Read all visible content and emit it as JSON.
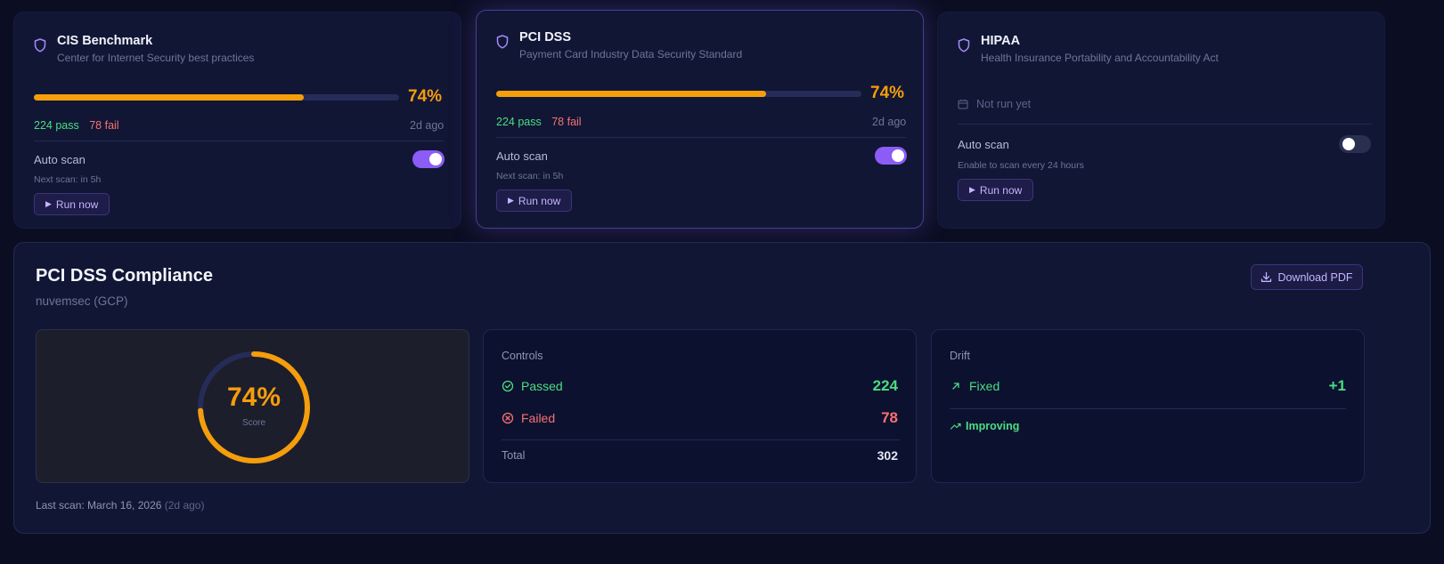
{
  "frameworks": [
    {
      "title": "CIS Benchmark",
      "subtitle": "Center for Internet Security best practices",
      "score_pct_value": 0.74,
      "score_pct": "74%",
      "pass": "224 pass",
      "fail": "78 fail",
      "ago": "2d ago",
      "auto_scan_label": "Auto scan",
      "auto_scan_on": true,
      "next_scan": "Next scan: in 5h",
      "run_label": "Run now"
    },
    {
      "title": "PCI DSS",
      "subtitle": "Payment Card Industry Data Security Standard",
      "score_pct_value": 0.74,
      "score_pct": "74%",
      "pass": "224 pass",
      "fail": "78 fail",
      "ago": "2d ago",
      "auto_scan_label": "Auto scan",
      "auto_scan_on": true,
      "next_scan": "Next scan: in 5h",
      "run_label": "Run now",
      "selected": true
    },
    {
      "title": "HIPAA",
      "subtitle": "Health Insurance Portability and Accountability Act",
      "not_run": "Not run yet",
      "auto_scan_label": "Auto scan",
      "auto_scan_on": false,
      "next_scan": "Enable to scan every 24 hours",
      "run_label": "Run now"
    }
  ],
  "detail": {
    "title": "PCI DSS Compliance",
    "subtitle": "nuvemsec (GCP)",
    "download_label": "Download PDF",
    "score": {
      "value": 0.74,
      "text": "74%",
      "label": "Score"
    },
    "controls": {
      "title": "Controls",
      "passed_label": "Passed",
      "passed_value": "224",
      "failed_label": "Failed",
      "failed_value": "78",
      "total_label": "Total",
      "total_value": "302"
    },
    "drift": {
      "title": "Drift",
      "fixed_label": "Fixed",
      "fixed_value": "+1",
      "trend_label": "Improving"
    },
    "last_scan": "Last scan: March 16, 2026",
    "last_scan_rel": "(2d ago)"
  },
  "colors": {
    "accent": "#8b5cf6",
    "warning": "#f59e0b",
    "success": "#4ade80",
    "danger": "#f87171"
  }
}
